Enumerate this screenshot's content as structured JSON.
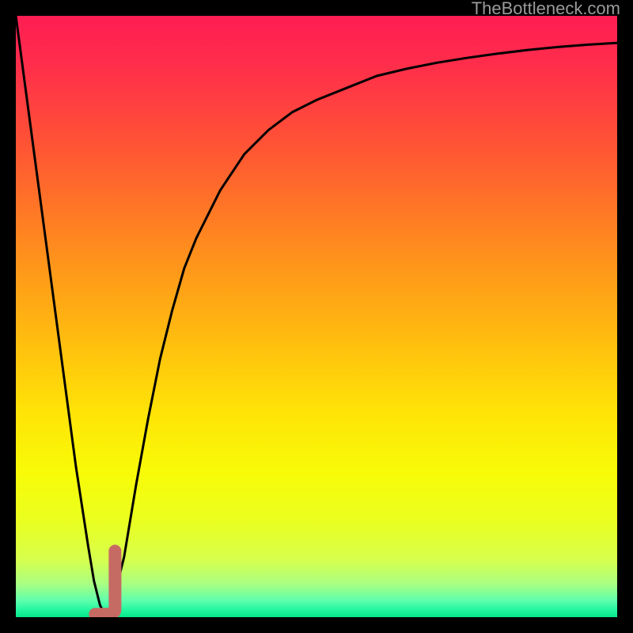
{
  "watermark": "TheBottleneck.com",
  "colors": {
    "frame": "#000000",
    "curve": "#000000",
    "marker": "#c66a64",
    "watermark": "#9a9a9a",
    "gradient_stops": [
      {
        "offset": 0.0,
        "color": "#ff1d53"
      },
      {
        "offset": 0.08,
        "color": "#ff2d4b"
      },
      {
        "offset": 0.22,
        "color": "#ff5534"
      },
      {
        "offset": 0.38,
        "color": "#ff8a1e"
      },
      {
        "offset": 0.52,
        "color": "#ffb710"
      },
      {
        "offset": 0.66,
        "color": "#ffe407"
      },
      {
        "offset": 0.76,
        "color": "#f8fb07"
      },
      {
        "offset": 0.84,
        "color": "#eaff20"
      },
      {
        "offset": 0.905,
        "color": "#d6ff4d"
      },
      {
        "offset": 0.945,
        "color": "#a9ff82"
      },
      {
        "offset": 0.972,
        "color": "#5fffac"
      },
      {
        "offset": 0.988,
        "color": "#22f6a0"
      },
      {
        "offset": 1.0,
        "color": "#06e688"
      }
    ]
  },
  "chart_data": {
    "type": "line",
    "title": "",
    "xlabel": "",
    "ylabel": "",
    "xlim": [
      0,
      100
    ],
    "ylim": [
      0,
      100
    ],
    "grid": false,
    "series": [
      {
        "name": "bottleneck-curve",
        "x": [
          0,
          2,
          4,
          6,
          8,
          10,
          12,
          13,
          14,
          15,
          16,
          18,
          20,
          22,
          24,
          26,
          28,
          30,
          34,
          38,
          42,
          46,
          50,
          55,
          60,
          65,
          70,
          75,
          80,
          85,
          90,
          95,
          100
        ],
        "y": [
          100,
          85,
          70,
          55,
          40,
          25,
          12,
          6,
          2,
          0,
          2,
          10,
          22,
          33,
          43,
          51,
          58,
          63,
          71,
          77,
          81,
          84,
          86,
          88,
          90,
          91.2,
          92.2,
          93,
          93.7,
          94.3,
          94.8,
          95.2,
          95.5
        ]
      }
    ],
    "marker": {
      "name": "optimal-point",
      "shape": "J",
      "x_range": [
        13.2,
        16.5
      ],
      "y_range": [
        0.5,
        11
      ],
      "color": "#c66a64"
    },
    "legend": false
  }
}
